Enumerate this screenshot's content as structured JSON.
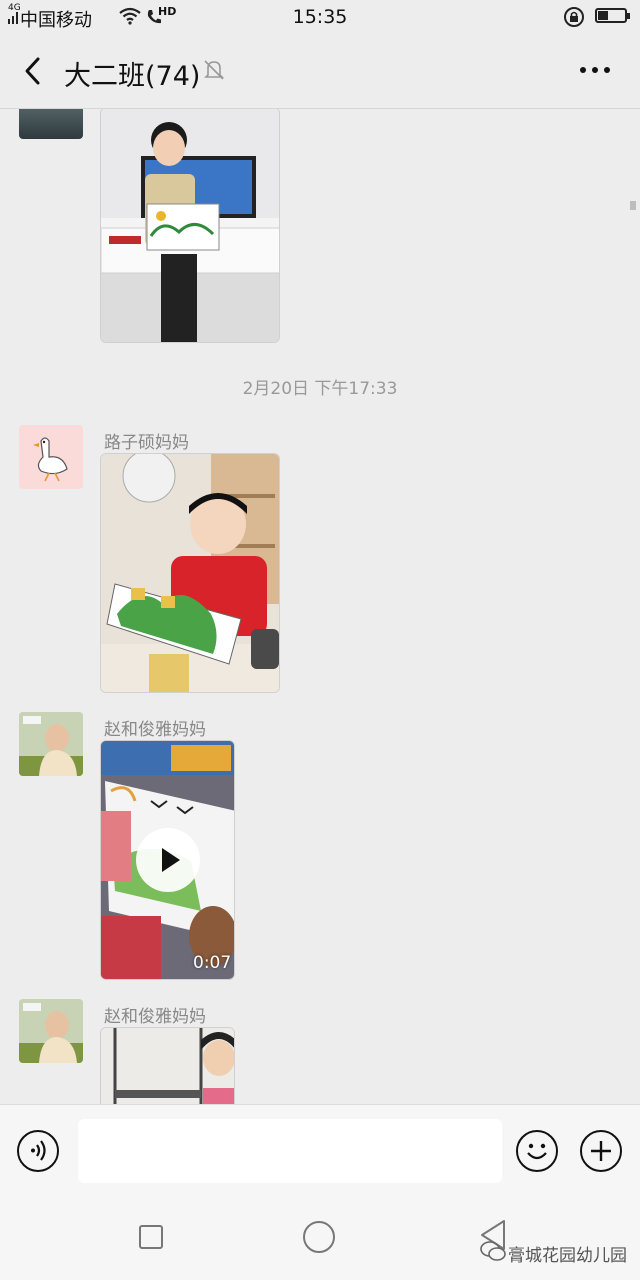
{
  "status_bar": {
    "network": "4G",
    "carrier": "中国移动",
    "hd": "HD",
    "time": "15:35"
  },
  "nav": {
    "title": "大二班(74)",
    "icons": [
      "back-arrow-icon",
      "bell-muted-icon",
      "more-icon"
    ]
  },
  "chat": {
    "timestamp": "2月20日 下午17:33",
    "messages": [
      {
        "sender": "",
        "type": "image",
        "content": "boy holding drawing in front of TV"
      },
      {
        "sender": "路子硕妈妈",
        "type": "image",
        "content": "boy in red sweater holding drawing"
      },
      {
        "sender": "赵和俊雅妈妈",
        "type": "video",
        "duration": "0:07"
      },
      {
        "sender": "赵和俊雅妈妈",
        "type": "image"
      }
    ]
  },
  "input_bar": {
    "icons": [
      "voice-icon",
      "emoji-icon",
      "plus-icon"
    ],
    "value": ""
  },
  "system_nav": {
    "icons": [
      "recent-apps-icon",
      "home-icon",
      "back-icon"
    ]
  },
  "watermark": "膏城花园幼儿园",
  "colors": {
    "background": "#ededed",
    "avatar_pink": "#fbdada",
    "text_secondary": "#888888"
  }
}
